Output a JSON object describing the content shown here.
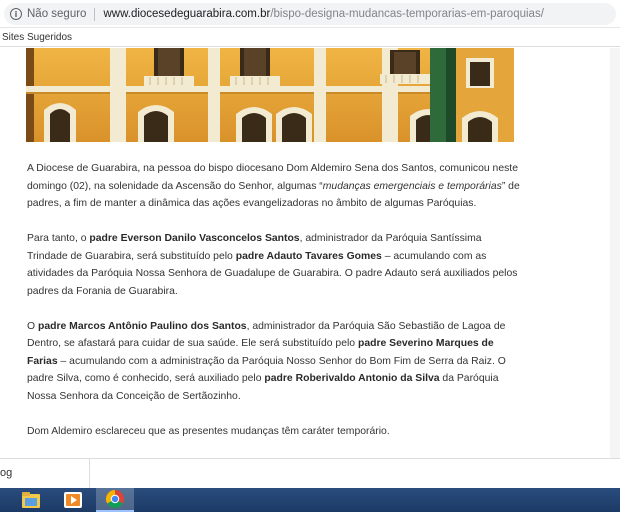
{
  "browser": {
    "security_label": "Não seguro",
    "url_host": "www.diocesedeguarabira.com.br",
    "url_path": "/bispo-designa-mudancas-temporarias-em-paroquias/"
  },
  "bookmarks": {
    "suggested_sites": "Sites Sugeridos"
  },
  "article": {
    "p1": {
      "a": "A Diocese de Guarabira, na pessoa do bispo diocesano Dom Aldemiro Sena dos Santos, comunicou neste domingo (02), na solenidade da Ascensão do Senhor, algumas “",
      "b": "mudanças emergenciais e temporárias",
      "c": "” de padres, a fim de manter a dinâmica das ações evangelizadoras no âmbito de algumas Paróquias."
    },
    "p2": {
      "a": "Para tanto, o ",
      "b": "padre Everson Danilo Vasconcelos Santos",
      "c": ", administrador da Paróquia Santíssima Trindade de Guarabira, será substituído pelo ",
      "d": "padre Adauto Tavares Gomes",
      "e": " – acumulando com as atividades da Paróquia Nossa Senhora de Guadalupe de Guarabira. O padre Adauto será auxiliados pelos padres da Forania de Guarabira."
    },
    "p3": {
      "a": "O ",
      "b": "padre Marcos Antônio Paulino dos Santos",
      "c": ", administrador da Paróquia São Sebastião de Lagoa de Dentro, se afastará para cuidar de sua saúde. Ele será substituído pelo ",
      "d": "padre Severino Marques de Farias",
      "e": " – acumulando com a administração da Paróquia Nosso Senhor do Bom Fim de Serra da Raiz. O padre Silva, como é conhecido, será auxiliado pelo ",
      "f": "padre Roberivaldo Antonio da Silva",
      "g": " da Paróquia Nossa Senhora da Conceição de Sertãozinho."
    },
    "p4": "Dom Aldemiro esclareceu que as presentes mudanças têm caráter temporário."
  },
  "findbar": {
    "partial_label": "og"
  },
  "taskbar": {
    "items": [
      "file-explorer-icon",
      "media-player-icon",
      "chrome-icon"
    ],
    "active": "chrome-icon"
  },
  "colors": {
    "building_wall": "#e8a62e",
    "building_trim": "#f3ead2",
    "taskbar": "#1f3f6e",
    "text": "#333333"
  }
}
